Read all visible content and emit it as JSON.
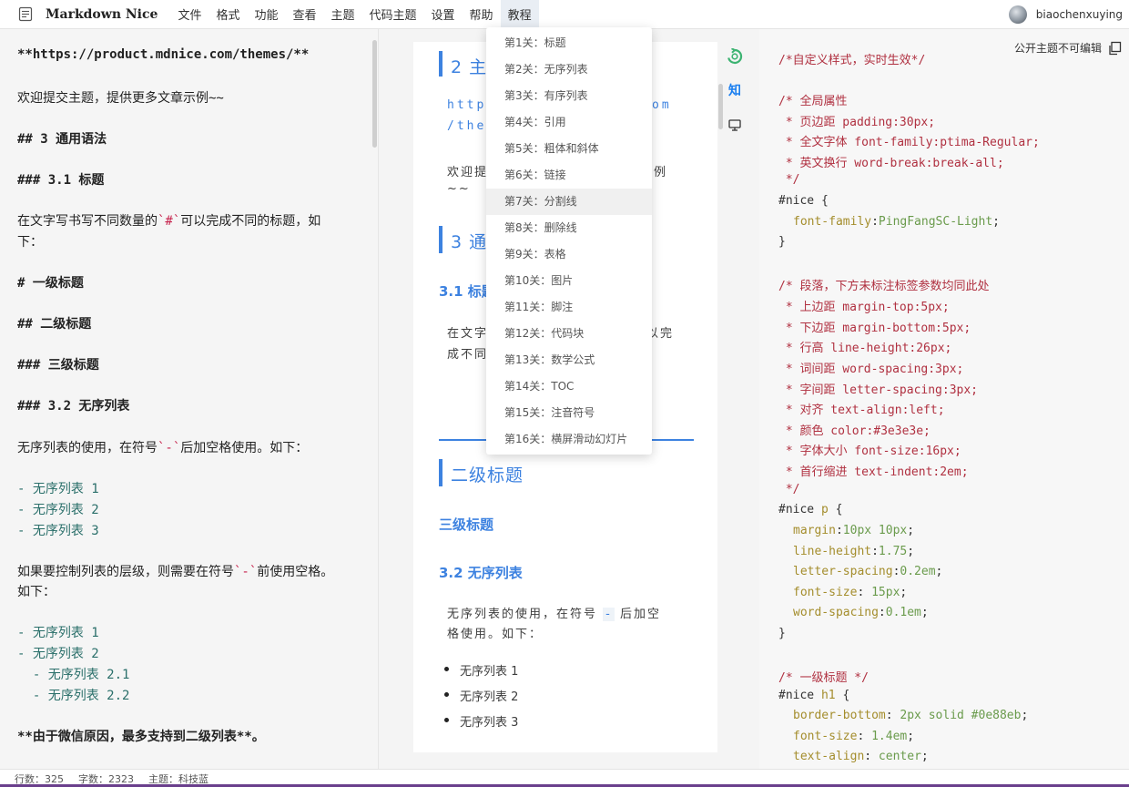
{
  "app": {
    "name": "Markdown Nice"
  },
  "menu": [
    "文件",
    "格式",
    "功能",
    "查看",
    "主题",
    "代码主题",
    "设置",
    "帮助",
    "教程"
  ],
  "user": {
    "name": "biaochenxuying"
  },
  "tutorial_menu": [
    "第1关：标题",
    "第2关：无序列表",
    "第3关：有序列表",
    "第4关：引用",
    "第5关：粗体和斜体",
    "第6关：链接",
    "第7关：分割线",
    "第8关：删除线",
    "第9关：表格",
    "第10关：图片",
    "第11关：脚注",
    "第12关：代码块",
    "第13关：数学公式",
    "第14关：TOC",
    "第15关：注音符号",
    "第16关：横屏滑动幻灯片"
  ],
  "editor": {
    "l1": "**https://product.mdnice.com/themes/**",
    "l2": "欢迎提交主题，提供更多文章示例~~",
    "l3": "## 3 通用语法",
    "l4": "### 3.1 标题",
    "l5a": "在文字写书写不同数量的",
    "l5b": "`#`",
    "l5c": "可以完成不同的标题，如",
    "l6": "下：",
    "l7": "# 一级标题",
    "l8": "## 二级标题",
    "l9": "### 三级标题",
    "l10": "### 3.2 无序列表",
    "l11a": "无序列表的使用，在符号",
    "l11b": "`-`",
    "l11c": "后加空格使用。如下：",
    "l12": "- 无序列表 1",
    "l13": "- 无序列表 2",
    "l14": "- 无序列表 3",
    "l15a": "如果要控制列表的层级，则需要在符号",
    "l15b": "`-`",
    "l15c": "前使用空格。",
    "l16": "如下：",
    "l17": "- 无序列表 1",
    "l18": "- 无序列表 2",
    "l19": "  - 无序列表 2.1",
    "l20": "  - 无序列表 2.2",
    "l21": "**由于微信原因，最多支持到二级列表**。"
  },
  "preview": {
    "h2_top": "2 主",
    "url_a": "https",
    "url_a2": "om",
    "url_b": "/ther",
    "welcome_a": "欢迎提",
    "welcome_a2": "例",
    "welcome_b": "~~",
    "h2_3": "3 通",
    "h3_1": "3.1 标题",
    "text_a": "在文字",
    "text_a2": "以完",
    "text_b": "成不同",
    "h2_level2": "二级标题",
    "h3_level3": "三级标题",
    "h3_32": "3.2 无序列表",
    "list_para_a": "无序列表的使用，在符号",
    "list_para_code": "-",
    "list_para_a2": "后加空",
    "list_para_b": "格使用。如下：",
    "bullets": [
      "无序列表 1",
      "无序列表 2",
      "无序列表 3"
    ]
  },
  "side_tools": {
    "zhihu": "知"
  },
  "css_panel": {
    "public_note": "公开主题不可编辑",
    "c1": "/*自定义样式，实时生效*/",
    "c2": "/* 全局属性",
    "c3": " * 页边距 padding:30px;",
    "c4": " * 全文字体 font-family:ptima-Regular;",
    "c5": " * 英文换行 word-break:break-all;",
    "c6": " */",
    "s1": "#nice {",
    "p1": "font-family",
    "v1": "PingFangSC-Light",
    "close1": "}",
    "c7": "/* 段落，下方未标注标签参数均同此处",
    "c8": " * 上边距 margin-top:5px;",
    "c9": " * 下边距 margin-bottom:5px;",
    "c10": " * 行高 line-height:26px;",
    "c11": " * 词间距 word-spacing:3px;",
    "c12": " * 字间距 letter-spacing:3px;",
    "c13": " * 对齐 text-align:left;",
    "c14": " * 颜色 color:#3e3e3e;",
    "c15": " * 字体大小 font-size:16px;",
    "c16": " * 首行缩进 text-indent:2em;",
    "c17": " */",
    "s2a": "#nice ",
    "s2b": "p",
    "s2c": " {",
    "p2": "margin",
    "v2": "10px 10px",
    "p3": "line-height",
    "v3": "1.75",
    "p4": "letter-spacing",
    "v4": "0.2em",
    "p5": "font-size",
    "v5": " 15px",
    "p6": "word-spacing",
    "v6": "0.1em",
    "close2": "}",
    "c18": "/* 一级标题 */",
    "s3a": "#nice ",
    "s3b": "h1",
    "s3c": " {",
    "p7": "border-bottom",
    "v7": " 2px solid #0e88eb",
    "p8": "font-size",
    "v8": " 1.4em",
    "p9": "text-align",
    "v9": " center"
  },
  "status": {
    "lines": "行数：325",
    "chars": "字数：2323",
    "theme": "主题：科技蓝"
  }
}
